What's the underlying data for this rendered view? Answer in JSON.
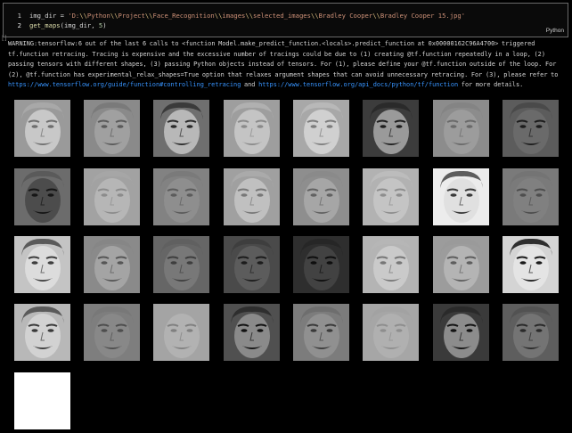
{
  "cell": {
    "execution_label": "[]",
    "language": "Python",
    "lines": [
      {
        "number": "1",
        "var": "img_dir",
        "op": " = ",
        "str_prefix": "'D:",
        "str_parts": [
          "\\\\",
          "Python",
          "\\\\",
          "Project",
          "\\\\",
          "Face_Recognition",
          "\\\\",
          "images",
          "\\\\",
          "selected_images",
          "\\\\",
          "Bradley Cooper",
          "\\\\",
          "Bradley Cooper 15.jpg'"
        ]
      },
      {
        "number": "2",
        "fn": "get_maps",
        "args_open": "(",
        "arg1": "img_dir",
        "sep": ", ",
        "arg2": "5",
        "args_close": ")"
      }
    ]
  },
  "output": {
    "warning_text": "WARNING:tensorflow:6 out of the last 6 calls to <function Model.make_predict_function.<locals>.predict_function at 0x00000162C96A4700> triggered tf.function retracing. Tracing is expensive and the excessive number of tracings could be due to (1) creating @tf.function repeatedly in a loop, (2) passing tensors with different shapes, (3) passing Python objects instead of tensors. For (1), please define your @tf.function outside of the loop. For (2), @tf.function has experimental_relax_shapes=True option that relaxes argument shapes that can avoid unnecessary retracing. For (3), please refer to",
    "link1": "https://www.tensorflow.org/guide/function#controlling_retracing",
    "between": " and ",
    "link2": "https://www.tensorflow.org/api_docs/python/tf/function",
    "tail": " for  more details."
  },
  "feature_maps": [
    {
      "bg": "#9a9a9a",
      "face": "#c8c8c8",
      "feat": "#6e6e6e",
      "hair": "#a8a8a8"
    },
    {
      "bg": "#8a8a8a",
      "face": "#a0a0a0",
      "feat": "#5a5a5a",
      "hair": "#7a7a7a"
    },
    {
      "bg": "#6f6f6f",
      "face": "#b8b8b8",
      "feat": "#2a2a2a",
      "hair": "#3a3a3a"
    },
    {
      "bg": "#9e9e9e",
      "face": "#c4c4c4",
      "feat": "#8a8a8a",
      "hair": "#b0b0b0"
    },
    {
      "bg": "#a8a8a8",
      "face": "#d0d0d0",
      "feat": "#7c7c7c",
      "hair": "#b8b8b8"
    },
    {
      "bg": "#3c3c3c",
      "face": "#9a9a9a",
      "feat": "#1e1e1e",
      "hair": "#2a2a2a"
    },
    {
      "bg": "#8c8c8c",
      "face": "#9c9c9c",
      "feat": "#6a6a6a",
      "hair": "#848484"
    },
    {
      "bg": "#5c5c5c",
      "face": "#6a6a6a",
      "feat": "#1c1c1c",
      "hair": "#4a4a4a"
    },
    {
      "bg": "#6c6c6c",
      "face": "#4c4c4c",
      "feat": "#161616",
      "hair": "#5a5a5a"
    },
    {
      "bg": "#a2a2a2",
      "face": "#b6b6b6",
      "feat": "#8c8c8c",
      "hair": "#a6a6a6"
    },
    {
      "bg": "#828282",
      "face": "#8e8e8e",
      "feat": "#5c5c5c",
      "hair": "#7a7a7a"
    },
    {
      "bg": "#a0a0a0",
      "face": "#c0c0c0",
      "feat": "#787878",
      "hair": "#aaaaaa"
    },
    {
      "bg": "#8e8e8e",
      "face": "#a6a6a6",
      "feat": "#626262",
      "hair": "#8a8a8a"
    },
    {
      "bg": "#b2b2b2",
      "face": "#c4c4c4",
      "feat": "#8e8e8e",
      "hair": "#bcbcbc"
    },
    {
      "bg": "#ececec",
      "face": "#e0e0e0",
      "feat": "#3a3a3a",
      "hair": "#5c5c5c"
    },
    {
      "bg": "#7a7a7a",
      "face": "#808080",
      "feat": "#4e4e4e",
      "hair": "#747474"
    },
    {
      "bg": "#c4c4c4",
      "face": "#dcdcdc",
      "feat": "#3e3e3e",
      "hair": "#5a5a5a"
    },
    {
      "bg": "#8a8a8a",
      "face": "#a4a4a4",
      "feat": "#565656",
      "hair": "#868686"
    },
    {
      "bg": "#666666",
      "face": "#787878",
      "feat": "#3e3e3e",
      "hair": "#606060"
    },
    {
      "bg": "#4a4a4a",
      "face": "#5c5c5c",
      "feat": "#1c1c1c",
      "hair": "#3e3e3e"
    },
    {
      "bg": "#2e2e2e",
      "face": "#424242",
      "feat": "#0e0e0e",
      "hair": "#262626"
    },
    {
      "bg": "#b4b4b4",
      "face": "#cacaca",
      "feat": "#767676",
      "hair": "#b6b6b6"
    },
    {
      "bg": "#9c9c9c",
      "face": "#b4b4b4",
      "feat": "#5e5e5e",
      "hair": "#9a9a9a"
    },
    {
      "bg": "#d4d4d4",
      "face": "#e4e4e4",
      "feat": "#1a1a1a",
      "hair": "#2e2e2e"
    },
    {
      "bg": "#b8b8b8",
      "face": "#d2d2d2",
      "feat": "#3a3a3a",
      "hair": "#5a5a5a"
    },
    {
      "bg": "#7e7e7e",
      "face": "#888888",
      "feat": "#4e4e4e",
      "hair": "#787878"
    },
    {
      "bg": "#a4a4a4",
      "face": "#b2b2b2",
      "feat": "#808080",
      "hair": "#a4a4a4"
    },
    {
      "bg": "#505050",
      "face": "#8a8a8a",
      "feat": "#121212",
      "hair": "#2e2e2e"
    },
    {
      "bg": "#7c7c7c",
      "face": "#909090",
      "feat": "#3a3a3a",
      "hair": "#6e6e6e"
    },
    {
      "bg": "#a6a6a6",
      "face": "#b0b0b0",
      "feat": "#8e8e8e",
      "hair": "#a2a2a2"
    },
    {
      "bg": "#3a3a3a",
      "face": "#8c8c8c",
      "feat": "#141414",
      "hair": "#2a2a2a"
    },
    {
      "bg": "#5e5e5e",
      "face": "#747474",
      "feat": "#2a2a2a",
      "hair": "#525252"
    },
    {
      "bg": "#ffffff",
      "face": "#ffffff",
      "feat": "#ffffff",
      "hair": "#ffffff"
    }
  ]
}
